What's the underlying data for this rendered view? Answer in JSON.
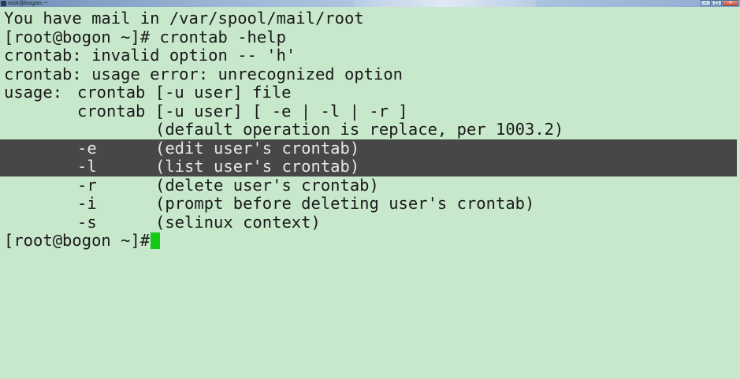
{
  "window": {
    "title": "root@bogon:~",
    "controls": {
      "minimize": "‒",
      "maximize": "□",
      "close": "✕"
    }
  },
  "terminal": {
    "lines": [
      [
        "You have mail in /var/spool/mail/root"
      ],
      [
        "[root@bogon ~]# crontab -help"
      ],
      [
        "crontab: invalid option -- 'h'"
      ],
      [
        "crontab: usage error: unrecognized option"
      ],
      [
        "usage:",
        "crontab [-u user] file"
      ],
      [
        "crontab [-u user] [ -e | -l | -r ]"
      ],
      [
        "(default operation is replace, per 1003.2)"
      ],
      [
        "-e",
        "(edit user's crontab)"
      ],
      [
        "-l",
        "(list user's crontab)"
      ],
      [
        "-r",
        "(delete user's crontab)"
      ],
      [
        "-i",
        "(prompt before deleting user's crontab)"
      ],
      [
        "-s",
        "(selinux context)"
      ],
      [
        "[root@bogon ~]#"
      ]
    ]
  },
  "colors": {
    "background": "#c8e8cb",
    "text": "#1a1a1a",
    "selection": "#474747",
    "selection_text": "#e6e6e6",
    "cursor": "#16c816"
  }
}
